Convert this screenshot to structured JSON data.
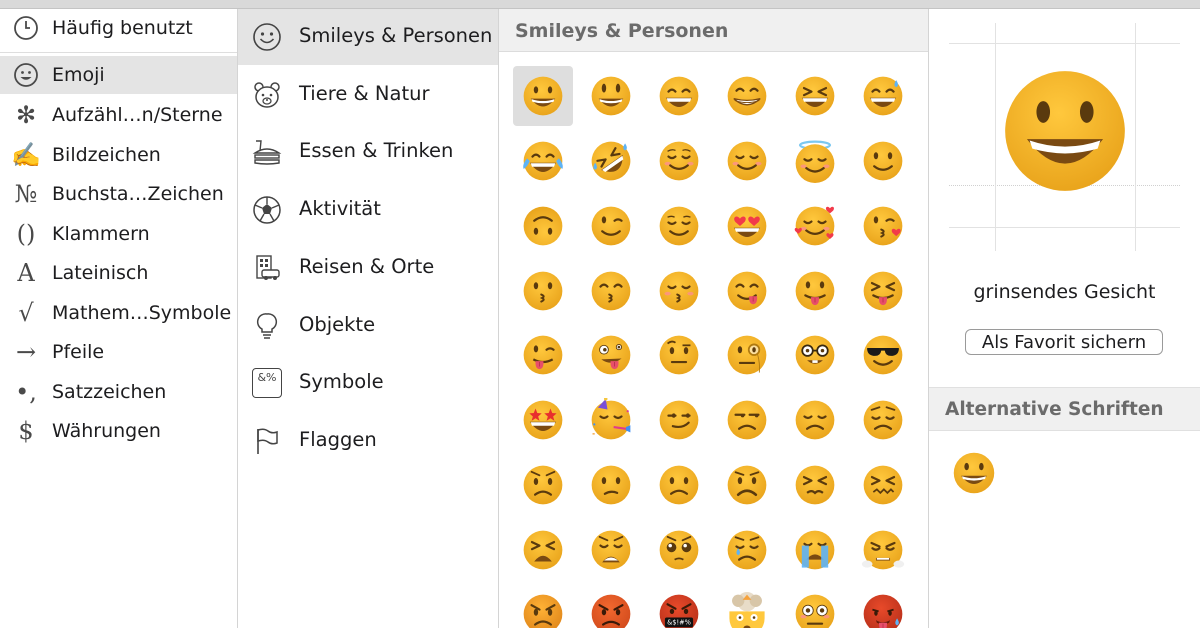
{
  "categories_sidebar": {
    "items": [
      {
        "label": "Häufig benutzt",
        "icon": "clock-icon"
      },
      {
        "label": "Emoji",
        "icon": "smiley-icon",
        "selected": true
      },
      {
        "label": "Aufzähl…n/Sterne",
        "icon": "asterisk-icon",
        "glyph": "✻"
      },
      {
        "label": "Bildzeichen",
        "icon": "pen-writing-icon",
        "glyph": "✍"
      },
      {
        "label": "Buchsta…Zeichen",
        "icon": "numero-icon",
        "glyph": "№"
      },
      {
        "label": "Klammern",
        "icon": "parentheses-icon",
        "glyph": "()"
      },
      {
        "label": "Lateinisch",
        "icon": "latin-a-icon",
        "glyph": "A"
      },
      {
        "label": "Mathem…Symbole",
        "icon": "square-root-icon",
        "glyph": "√"
      },
      {
        "label": "Pfeile",
        "icon": "arrow-right-icon",
        "glyph": "→"
      },
      {
        "label": "Satzzeichen",
        "icon": "punctuation-icon",
        "glyph": "•,"
      },
      {
        "label": "Währungen",
        "icon": "dollar-icon",
        "glyph": "$"
      }
    ]
  },
  "emoji_groups": {
    "items": [
      {
        "label": "Smileys & Personen",
        "icon": "smiley-outline-icon",
        "selected": true
      },
      {
        "label": "Tiere & Natur",
        "icon": "bear-icon"
      },
      {
        "label": "Essen & Trinken",
        "icon": "burger-drink-icon"
      },
      {
        "label": "Aktivität",
        "icon": "soccer-ball-icon"
      },
      {
        "label": "Reisen & Orte",
        "icon": "building-car-icon"
      },
      {
        "label": "Objekte",
        "icon": "lightbulb-icon"
      },
      {
        "label": "Symbole",
        "icon": "symbols-icon",
        "glyph": "&%"
      },
      {
        "label": "Flaggen",
        "icon": "flag-icon"
      }
    ]
  },
  "emoji_grid": {
    "title": "Smileys & Personen",
    "rows": [
      [
        "grinning",
        "smiley",
        "smile",
        "grin",
        "laughing",
        "sweat-smile"
      ],
      [
        "joy",
        "rofl",
        "relaxed",
        "blush",
        "innocent",
        "slight-smile"
      ],
      [
        "upside-down",
        "wink",
        "relieved",
        "heart-eyes",
        "smiling-hearts",
        "kissing-heart"
      ],
      [
        "kissing",
        "kissing-smiling",
        "kissing-closed",
        "yum",
        "tongue",
        "squint-tongue"
      ],
      [
        "wink-tongue",
        "zany",
        "raised-eyebrow",
        "monocle",
        "nerd",
        "sunglasses"
      ],
      [
        "star-struck",
        "partying",
        "smirk",
        "unamused",
        "disappointed",
        "pensive"
      ],
      [
        "worried",
        "confused",
        "slight-frown",
        "frowning",
        "persevering",
        "confounded"
      ],
      [
        "tired",
        "weary",
        "pleading",
        "crying",
        "sob",
        "triumph"
      ],
      [
        "angry",
        "pouting",
        "cursing",
        "exploding",
        "flushed",
        "hot"
      ]
    ],
    "cursing_text": "&$!#%"
  },
  "detail": {
    "name": "grinsendes Gesicht",
    "favorite_label": "Als Favorit sichern",
    "alt_header": "Alternative Schriften"
  },
  "colors": {
    "face_fill": "#FFC83D",
    "face_edge": "#E8A21A",
    "feature": "#5A3A0E",
    "mouth": "#7A4A12",
    "teeth": "#FFFFFF",
    "blush": "#FF8A9A",
    "heart": "#F23A4A",
    "tear": "#5EB3F5",
    "angry_fill": "#F2682F",
    "angry_edge": "#D14A1C",
    "red_fill": "#E84A2A",
    "selection": "#E4E4E4"
  }
}
